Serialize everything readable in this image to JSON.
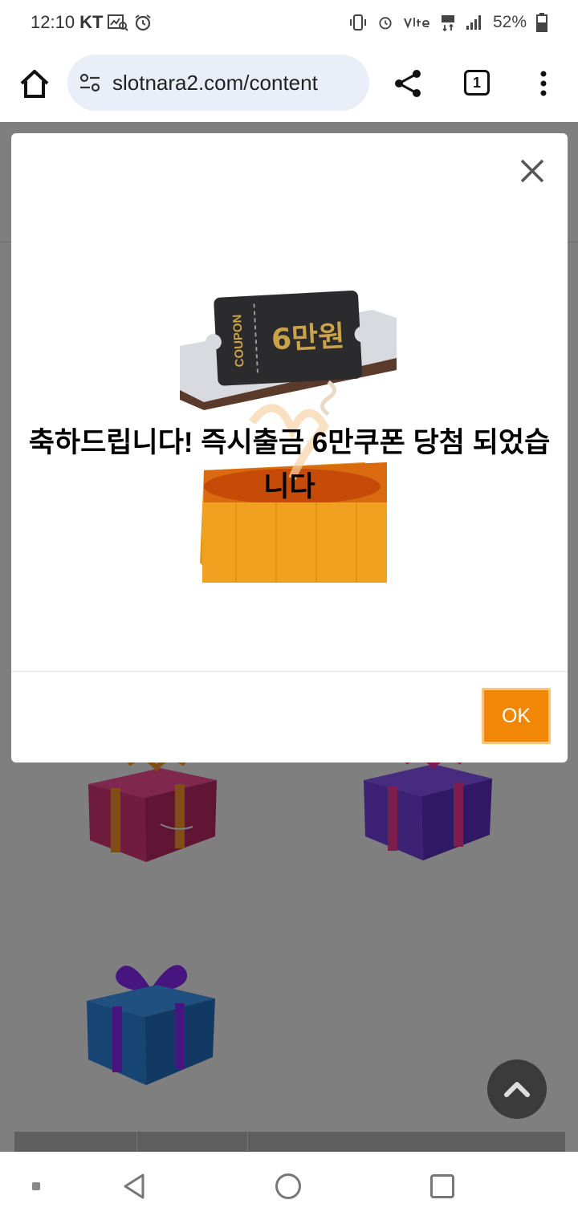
{
  "status_bar": {
    "time": "12:10",
    "carrier": "KT",
    "battery": "52%"
  },
  "browser": {
    "url": "slotnara2.com/content",
    "tab_count": "1"
  },
  "modal": {
    "message": "축하드립니다! 즉시출금 6만쿠폰 당첨 되었습니다",
    "ok_label": "OK",
    "coupon_word": "COUPON",
    "coupon_amount": "6만원"
  },
  "colors": {
    "ok_button": "#f28705",
    "overlay": "rgba(0,0,0,0.5)"
  }
}
